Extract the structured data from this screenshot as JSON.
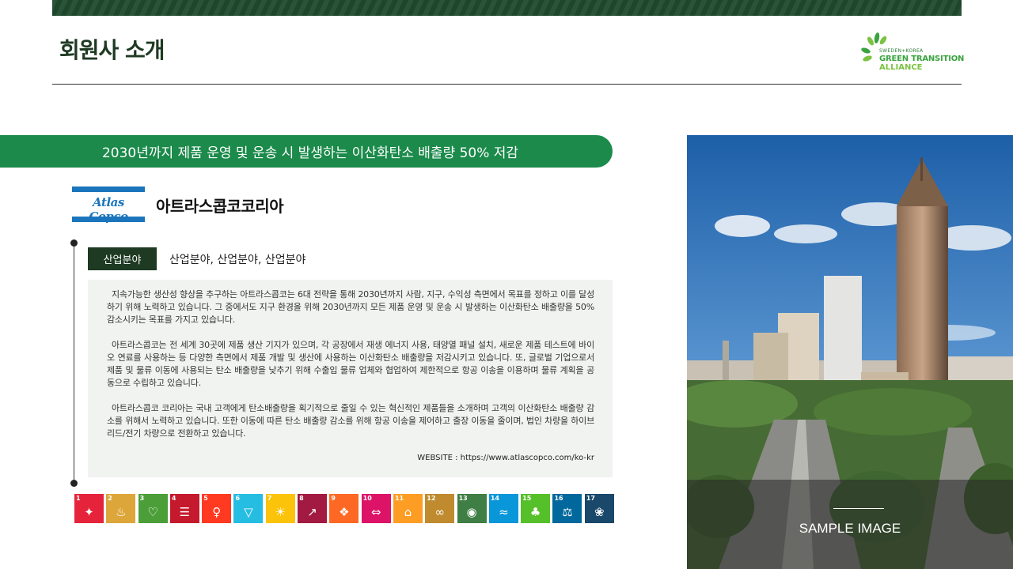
{
  "header": {
    "title": "회원사 소개",
    "logo": {
      "line1": "SWEDEN+KOREA",
      "line2": "GREEN TRANSITION",
      "line3": "ALLIANCE"
    }
  },
  "goal_banner": "2030년까지 제품 운영 및 운송 시 발생하는 이산화탄소 배출량 50% 저감",
  "company": {
    "logo_text": "Atlas Copco",
    "name": "아트라스콥코코리아"
  },
  "industry": {
    "tag": "산업분야",
    "value": "산업분야, 산업분야, 산업분야"
  },
  "description": {
    "paragraphs": [
      "지속가능한 생산성 향상을 추구하는 아트라스콥코는 6대 전략을 통해 2030년까지 사람, 지구, 수익성 측면에서 목표를 정하고 이를 달성하기 위해 노력하고 있습니다. 그 중에서도 지구 환경을 위해 2030년까지 모든 제품 운영 및 운송 시 발생하는 이산화탄소 배출량을 50% 감소시키는 목표를 가지고 있습니다.",
      "아트라스콥코는 전 세계 30곳에 제품 생산 기지가 있으며, 각 공장에서 재생 에너지 사용, 태양열 패널 설치, 새로운 제품 테스트에 바이오 연료를 사용하는 등 다양한 측면에서 제품 개발 및 생산에 사용하는 이산화탄소 배출량을 저감시키고 있습니다. 또, 글로벌 기업으로서 제품 및 물류 이동에 사용되는 탄소 배출량을 낮추기 위해 수출입 물류 업체와 협업하여 제한적으로 항공 이송을 이용하며 물류 계획을 공동으로 수립하고 있습니다.",
      "아트라스콥코 코리아는 국내 고객에게 탄소배출량을 획기적으로 줄일 수 있는 혁신적인 제품들을 소개하며 고객의 이산화탄소 배출량 감소를 위해서 노력하고 있습니다. 또한 이동에 따른 탄소 배출량 감소를 위해 항공 이송을 제어하고 출장 이동을 줄이며, 법인 차량을 하이브리드/전기 차량으로 전환하고 있습니다."
    ],
    "website": "WEBSITE : https://www.atlascopco.com/ko-kr"
  },
  "sdgs": [
    {
      "num": "1",
      "icon": "family-icon",
      "glyph": "✦",
      "color": "#e5243b"
    },
    {
      "num": "2",
      "icon": "bowl-icon",
      "glyph": "♨",
      "color": "#dda63a"
    },
    {
      "num": "3",
      "icon": "heartbeat-icon",
      "glyph": "♡",
      "color": "#4c9f38"
    },
    {
      "num": "4",
      "icon": "book-icon",
      "glyph": "☰",
      "color": "#c5192d"
    },
    {
      "num": "5",
      "icon": "gender-icon",
      "glyph": "♀",
      "color": "#ff3a21"
    },
    {
      "num": "6",
      "icon": "water-drop-icon",
      "glyph": "▽",
      "color": "#26bde2"
    },
    {
      "num": "7",
      "icon": "sun-icon",
      "glyph": "☀",
      "color": "#fcc30b"
    },
    {
      "num": "8",
      "icon": "growth-chart-icon",
      "glyph": "↗",
      "color": "#a21942"
    },
    {
      "num": "9",
      "icon": "cubes-icon",
      "glyph": "❖",
      "color": "#fd6925"
    },
    {
      "num": "10",
      "icon": "equality-icon",
      "glyph": "⇔",
      "color": "#dd1367"
    },
    {
      "num": "11",
      "icon": "city-icon",
      "glyph": "⌂",
      "color": "#fd9d24"
    },
    {
      "num": "12",
      "icon": "infinity-icon",
      "glyph": "∞",
      "color": "#bf8b2e"
    },
    {
      "num": "13",
      "icon": "eye-icon",
      "glyph": "◉",
      "color": "#3f7e44"
    },
    {
      "num": "14",
      "icon": "fish-icon",
      "glyph": "≈",
      "color": "#0a97d9"
    },
    {
      "num": "15",
      "icon": "tree-icon",
      "glyph": "♣",
      "color": "#56c02b"
    },
    {
      "num": "16",
      "icon": "dove-icon",
      "glyph": "⚖",
      "color": "#00689d"
    },
    {
      "num": "17",
      "icon": "partnership-icon",
      "glyph": "❀",
      "color": "#19486a"
    }
  ],
  "photo": {
    "caption": "SAMPLE IMAGE"
  }
}
